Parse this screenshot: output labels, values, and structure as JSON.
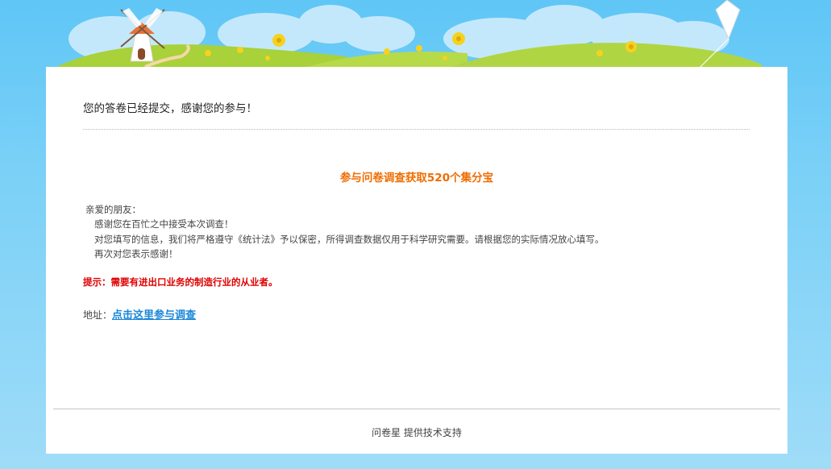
{
  "confirmation": {
    "message": "您的答卷已经提交，感谢您的参与！"
  },
  "promo": {
    "title": "参与问卷调查获取520个集分宝"
  },
  "letter": {
    "greeting": "亲爱的朋友：",
    "lines": [
      "感谢您在百忙之中接受本次调查！",
      "对您填写的信息，我们将严格遵守《统计法》予以保密，所得调查数据仅用于科学研究需要。请根据您的实际情况放心填写。",
      "再次对您表示感谢！"
    ]
  },
  "tip": {
    "text": "提示：需要有进出口业务的制造行业的从业者。"
  },
  "address": {
    "label": "地址：",
    "link_text": "点击这里参与调查"
  },
  "footer": {
    "text": "问卷星 提供技术支持"
  },
  "colors": {
    "sky": "#5fc6f6",
    "promo_orange": "#ef6c00",
    "tip_red": "#e00000",
    "link_blue": "#1a86d8"
  },
  "icons": [
    "windmill-icon",
    "flower-icon",
    "kite-icon"
  ]
}
